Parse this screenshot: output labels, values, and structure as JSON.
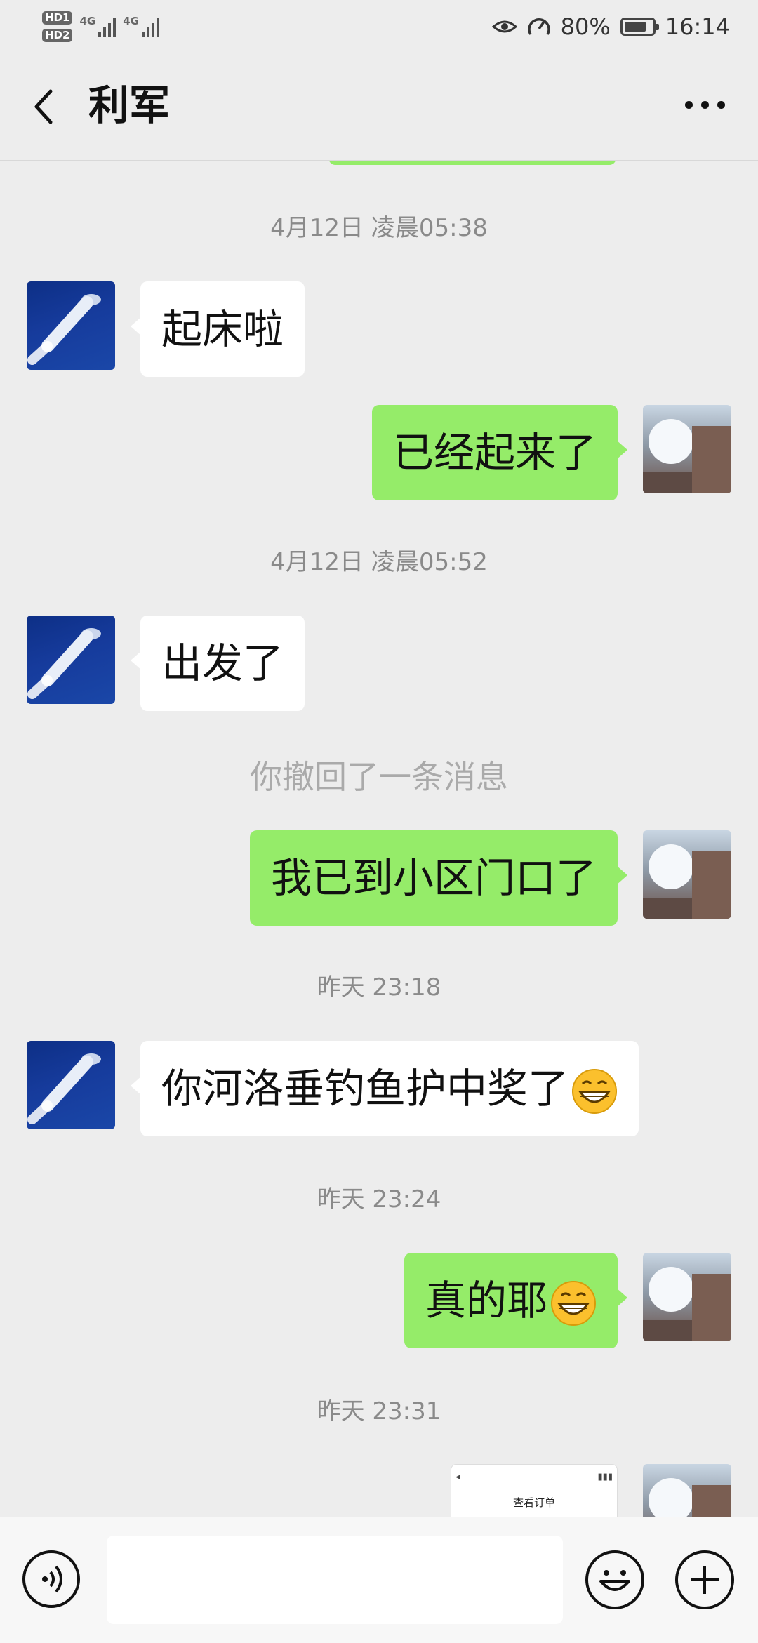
{
  "status_bar": {
    "hd1": "HD1",
    "hd2": "HD2",
    "net1": "4G",
    "net2": "4G",
    "battery_text": "80%",
    "battery_level": 0.8,
    "time": "16:14"
  },
  "header": {
    "title": "利军"
  },
  "messages": [
    {
      "type": "timestamp",
      "text": "4月12日 凌晨05:38"
    },
    {
      "type": "incoming",
      "text": "起床啦"
    },
    {
      "type": "outgoing",
      "text": "已经起来了"
    },
    {
      "type": "timestamp",
      "text": "4月12日 凌晨05:52"
    },
    {
      "type": "incoming",
      "text": "出发了"
    },
    {
      "type": "system",
      "text": "你撤回了一条消息"
    },
    {
      "type": "outgoing",
      "text": "我已到小区门口了"
    },
    {
      "type": "timestamp",
      "text": "昨天 23:18"
    },
    {
      "type": "incoming",
      "text": "你河洛垂钓鱼护中奖了",
      "emoji": "grin"
    },
    {
      "type": "timestamp",
      "text": "昨天 23:24"
    },
    {
      "type": "outgoing",
      "text": "真的耶",
      "emoji": "grin"
    },
    {
      "type": "timestamp",
      "text": "昨天 23:31"
    },
    {
      "type": "outgoing-image",
      "caption": "查看订单"
    }
  ],
  "icons": {
    "back": "back-arrow-icon",
    "more": "more-dots-icon",
    "voice": "voice-icon",
    "emoji": "emoji-icon",
    "plus": "plus-icon"
  },
  "colors": {
    "outgoing_bubble": "#95ec69",
    "incoming_bubble": "#ffffff",
    "background": "#ededed"
  }
}
